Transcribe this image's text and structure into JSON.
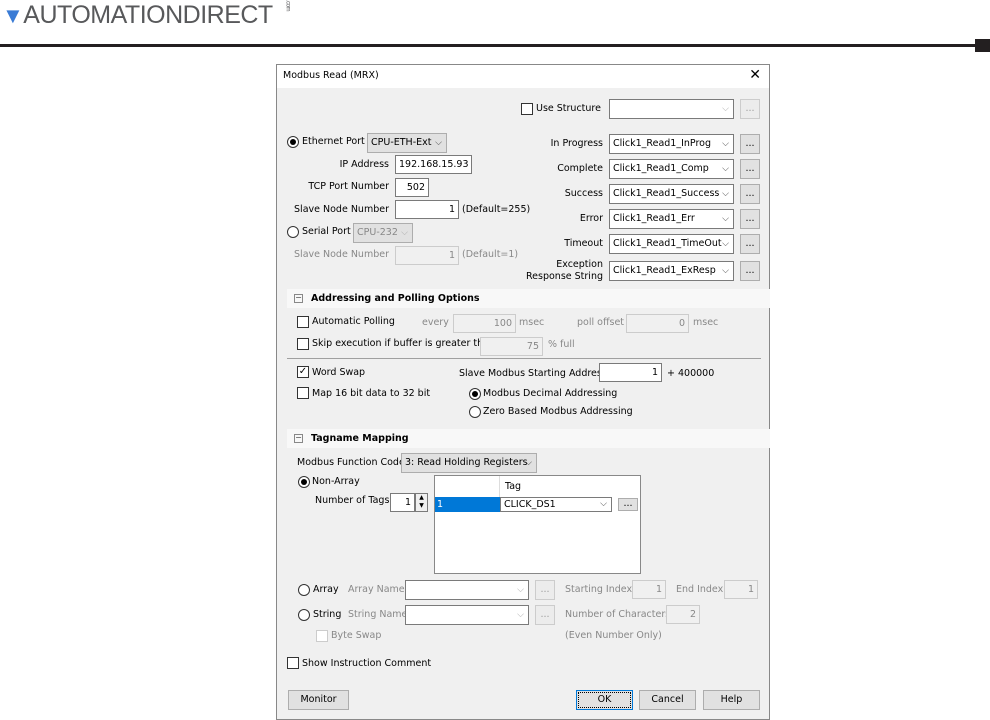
{
  "header": {
    "logo_text": "AUTOMATIONDIRECT",
    "logo_suffix": ".com"
  },
  "dialog": {
    "title": "Modbus Read (MRX)",
    "close_icon": "close-icon",
    "use_structure": {
      "label": "Use Structure",
      "checked": false,
      "value": ""
    },
    "ethernet": {
      "label": "Ethernet Port",
      "selected": true,
      "port": "CPU-ETH-Ext",
      "ip_label": "IP Address",
      "ip": "192.168.15.93",
      "tcp_label": "TCP Port Number",
      "tcp": "502",
      "slave_label": "Slave Node Number",
      "slave": "1",
      "slave_default": "(Default=255)"
    },
    "serial": {
      "label": "Serial Port",
      "selected": false,
      "port": "CPU-232",
      "slave_label": "Slave Node Number",
      "slave": "1",
      "slave_default": "(Default=1)"
    },
    "status": [
      {
        "label": "In Progress",
        "value": "Click1_Read1_InProg"
      },
      {
        "label": "Complete",
        "value": "Click1_Read1_Comp"
      },
      {
        "label": "Success",
        "value": "Click1_Read1_Success"
      },
      {
        "label": "Error",
        "value": "Click1_Read1_Err"
      },
      {
        "label": "Timeout",
        "value": "Click1_Read1_TimeOut"
      },
      {
        "label": "Exception Response String",
        "value": "Click1_Read1_ExResp"
      }
    ],
    "browse_label": "...",
    "addressing": {
      "title": "Addressing and Polling Options",
      "auto_polling": "Automatic Polling",
      "every": "every",
      "every_value": "100",
      "msec": "msec",
      "poll_offset": "poll offset",
      "poll_offset_value": "0",
      "skip": "Skip execution if buffer is greater than",
      "skip_value": "75",
      "pct_full": "% full",
      "word_swap": "Word Swap",
      "word_swap_checked": true,
      "map16": "Map 16 bit data to 32 bit",
      "start_addr_label": "Slave Modbus Starting Address",
      "start_addr": "1",
      "offset": "+ 400000",
      "decimal": "Modbus Decimal Addressing",
      "zero_based": "Zero Based Modbus Addressing"
    },
    "tagname": {
      "title": "Tagname Mapping",
      "fc_label": "Modbus Function Code",
      "fc": "3: Read Holding Registers",
      "non_array": "Non-Array",
      "num_tags_label": "Number of Tags",
      "num_tags": "1",
      "col_tag": "Tag",
      "rows": [
        {
          "index": "1",
          "tag": "CLICK_DS1"
        }
      ],
      "array": "Array",
      "array_name": "Array Name",
      "starting_index": "Starting Index",
      "starting_index_value": "1",
      "end_index": "End Index",
      "end_index_value": "1",
      "string": "String",
      "string_name": "String Name",
      "num_chars": "Number of Characters",
      "num_chars_value": "2",
      "byte_swap": "Byte Swap",
      "even_only": "(Even Number Only)"
    },
    "show_comment": "Show Instruction Comment",
    "buttons": {
      "monitor": "Monitor",
      "ok": "OK",
      "cancel": "Cancel",
      "help": "Help"
    }
  },
  "colors": {
    "selection": "#0078d7",
    "dialog_bg": "#f0f0f0"
  }
}
